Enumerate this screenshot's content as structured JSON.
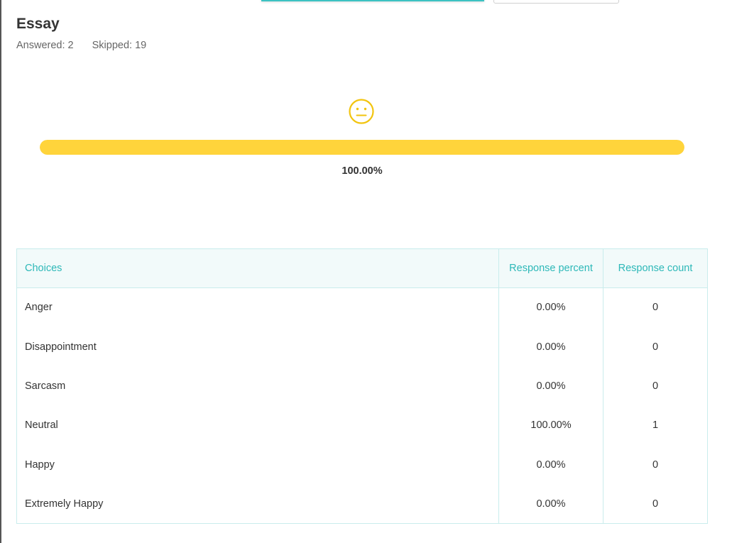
{
  "question": {
    "title": "Essay",
    "answered": "Answered: 2",
    "skipped": "Skipped: 19"
  },
  "summary": {
    "icon": "neutral-face-icon",
    "percent_label": "100.00%",
    "fill_fraction": 1.0,
    "bar_color": "#ffd43b"
  },
  "table": {
    "headers": [
      "Choices",
      "Response percent",
      "Response count"
    ],
    "rows": [
      {
        "choice": "Anger",
        "percent": "0.00%",
        "count": "0"
      },
      {
        "choice": "Disappointment",
        "percent": "0.00%",
        "count": "0"
      },
      {
        "choice": "Sarcasm",
        "percent": "0.00%",
        "count": "0"
      },
      {
        "choice": "Neutral",
        "percent": "100.00%",
        "count": "1"
      },
      {
        "choice": "Happy",
        "percent": "0.00%",
        "count": "0"
      },
      {
        "choice": "Extremely Happy",
        "percent": "0.00%",
        "count": "0"
      }
    ]
  },
  "colors": {
    "accent": "#2db8b8",
    "table_border": "#c9ecec",
    "header_bg": "#f2fafa",
    "face": "#f2c40f"
  }
}
